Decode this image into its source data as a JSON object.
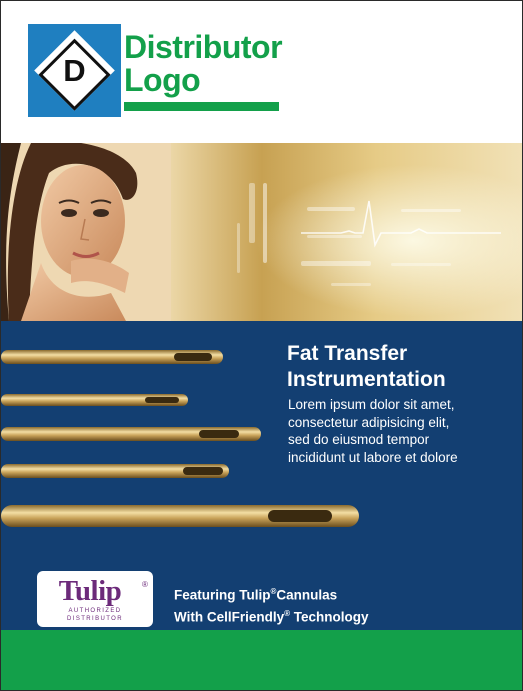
{
  "logo": {
    "letter": "D",
    "line1": "Distributor",
    "line2": "Logo",
    "icon": "diamond-logo-icon"
  },
  "colors": {
    "brand_green": "#13a04a",
    "logo_blue": "#1f7fc0",
    "panel_blue": "#133f72",
    "tulip_purple": "#6c2a7a",
    "cannula_gold": "#c9a35a"
  },
  "hero": {
    "image": "woman-portrait-with-gold-ecg-background"
  },
  "product": {
    "title_line1": "Fat Transfer",
    "title_line2": "Instrumentation",
    "body_lines": [
      "Lorem ipsum dolor sit amet,",
      "consectetur adipisicing elit,",
      "sed do eiusmod tempor",
      "incididunt ut labore et dolore"
    ]
  },
  "badge": {
    "word": "Tulip",
    "reg": "®",
    "sub1": "AUTHORIZED",
    "sub2": "DISTRIBUTOR"
  },
  "featuring": {
    "line1_a": "Featuring Tulip",
    "line1_reg": "®",
    "line1_b": "Cannulas",
    "line2_a": "With CellFriendly",
    "line2_reg": "®",
    "line2_b": " Technology"
  }
}
